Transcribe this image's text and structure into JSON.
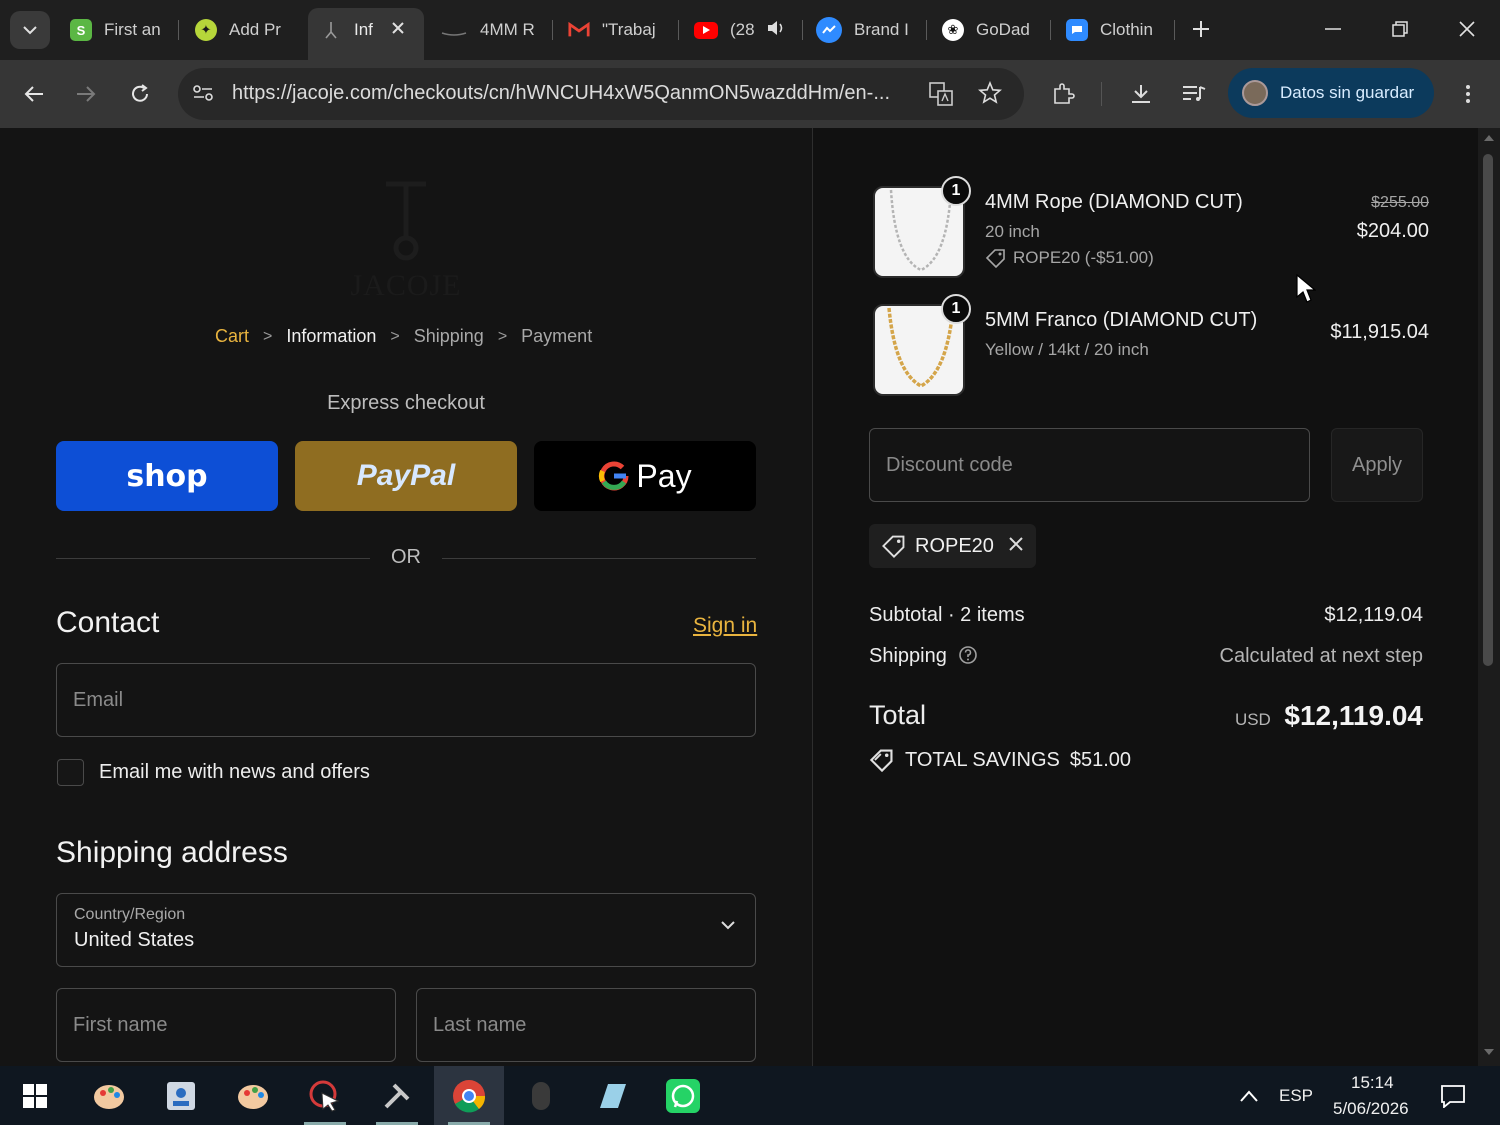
{
  "browser": {
    "tabs": [
      {
        "title": "First an",
        "icon": "shopify-s-icon",
        "color": "#5bb744"
      },
      {
        "title": "Add Pr",
        "icon": "chatgpt-icon",
        "color": "#b6d63a"
      },
      {
        "title": "Inf",
        "icon": "jacoje-icon",
        "color": "#8a8a8a",
        "active": true
      },
      {
        "title": "4MM R",
        "icon": "chain-icon",
        "color": "#777777"
      },
      {
        "title": "\"Trabaj",
        "icon": "gmail-icon",
        "color": "#ea4335"
      },
      {
        "title": "(28",
        "icon": "youtube-icon",
        "color": "#ff0000"
      },
      {
        "title": "Brand I",
        "icon": "messenger-icon",
        "color": "#2f8bff"
      },
      {
        "title": "GoDad",
        "icon": "openai-icon",
        "color": "#ffffff"
      },
      {
        "title": "Clothin",
        "icon": "chat-icon",
        "color": "#2f8bff"
      }
    ],
    "url": "https://jacoje.com/checkouts/cn/hWNCUH4xW5QanmON5wazddHm/en-...",
    "profile_label": "Datos sin guardar"
  },
  "store": {
    "logo_text": "JACOJE"
  },
  "breadcrumb": {
    "cart": "Cart",
    "information": "Information",
    "shipping": "Shipping",
    "payment": "Payment"
  },
  "express": {
    "title": "Express checkout",
    "shop_label": "shop",
    "paypal_label": "PayPal",
    "gpay_label": "Pay",
    "or_label": "OR"
  },
  "contact": {
    "heading": "Contact",
    "sign_in": "Sign in",
    "email_placeholder": "Email",
    "news_label": "Email me with news and offers"
  },
  "shipping_address": {
    "heading": "Shipping address",
    "country_label": "Country/Region",
    "country_value": "United States",
    "first_name_placeholder": "First name",
    "last_name_placeholder": "Last name"
  },
  "order": {
    "items": [
      {
        "qty": "1",
        "name": "4MM Rope (DIAMOND CUT)",
        "variant": "20 inch",
        "discount": "ROPE20 (-$51.00)",
        "old_price": "$255.00",
        "price": "$204.00",
        "chain_color": "#b8b8b8"
      },
      {
        "qty": "1",
        "name": "5MM Franco (DIAMOND CUT)",
        "variant": "Yellow / 14kt / 20 inch",
        "price": "$11,915.04",
        "chain_color": "#d4a54a"
      }
    ],
    "discount_placeholder": "Discount code",
    "apply_label": "Apply",
    "applied_code": "ROPE20",
    "subtotal_label": "Subtotal · 2 items",
    "subtotal_value": "$12,119.04",
    "shipping_label": "Shipping",
    "shipping_value": "Calculated at next step",
    "total_label": "Total",
    "currency": "USD",
    "total_value": "$12,119.04",
    "savings_label": "TOTAL SAVINGS",
    "savings_value": "$51.00"
  },
  "taskbar": {
    "language": "ESP",
    "time": "15:14",
    "date": "5/06/2026"
  }
}
